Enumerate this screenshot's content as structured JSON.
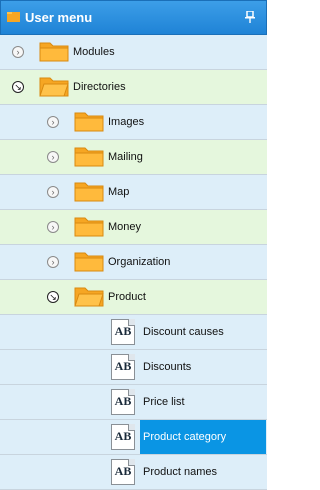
{
  "header": {
    "title": "User menu",
    "icons": [
      "folder-icon",
      "pin-icon"
    ]
  },
  "tree": {
    "root": [
      {
        "label": "Modules",
        "icon": "folder-icon",
        "expanded": false
      },
      {
        "label": "Directories",
        "icon": "folder-open-icon",
        "expanded": true,
        "children": [
          {
            "label": "Images",
            "icon": "folder-icon"
          },
          {
            "label": "Mailing",
            "icon": "folder-icon"
          },
          {
            "label": "Map",
            "icon": "folder-icon"
          },
          {
            "label": "Money",
            "icon": "folder-icon"
          },
          {
            "label": "Organization",
            "icon": "folder-icon"
          },
          {
            "label": "Product",
            "icon": "folder-open-icon",
            "expanded": true,
            "children": [
              {
                "label": "Discount causes",
                "icon": "ab-document-icon",
                "icon_text": "AB"
              },
              {
                "label": "Discounts",
                "icon": "ab-document-icon",
                "icon_text": "AB"
              },
              {
                "label": "Price list",
                "icon": "ab-document-icon",
                "icon_text": "AB"
              },
              {
                "label": "Product category",
                "icon": "ab-document-icon",
                "icon_text": "AB",
                "selected": true
              },
              {
                "label": "Product names",
                "icon": "ab-document-icon",
                "icon_text": "AB"
              }
            ]
          }
        ]
      }
    ]
  },
  "colors": {
    "header": "#2b90e0",
    "row_blue": "#ddeef9",
    "row_green": "#e5f7dd",
    "selection": "#0a95e4",
    "folder": "#f5a623"
  }
}
